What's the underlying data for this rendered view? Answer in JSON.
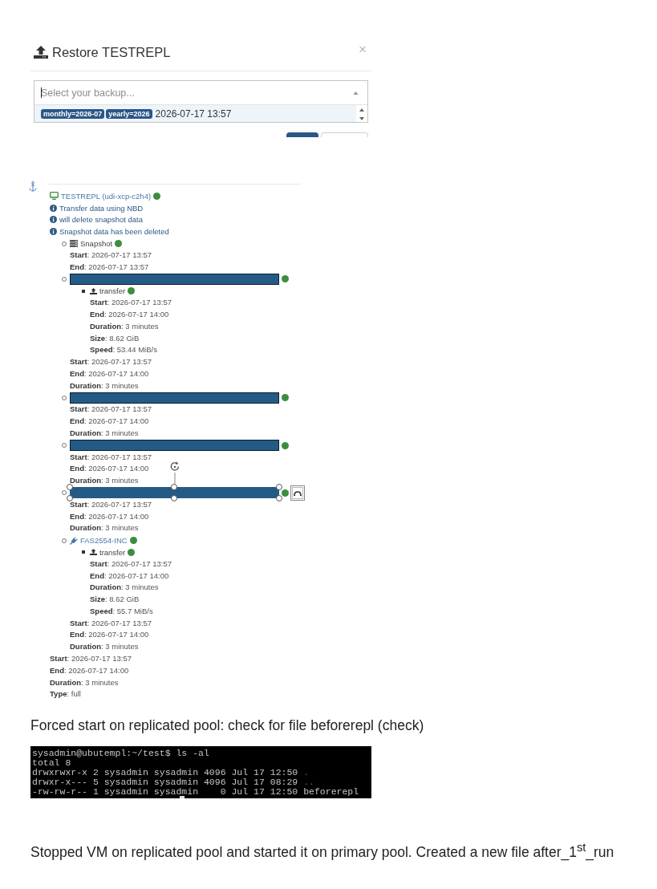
{
  "dialog": {
    "title": "Restore TESTREPL",
    "close": "×",
    "select": {
      "placeholder": "Select your backup...",
      "options": [
        {
          "tags": [
            "monthly=2026-07",
            "yearly=2026"
          ],
          "label": "2026-07-17 13:57",
          "selected": true
        }
      ]
    }
  },
  "log": {
    "kind": "vm",
    "label": "TESTREPL (udi-xcp-c2h4)",
    "color": "#3c8d40",
    "messages": [
      "Transfer data using NBD",
      "will delete snapshot data",
      "Snapshot data has been deleted"
    ],
    "tasks": [
      {
        "kind": "snapshot",
        "label": "Snapshot",
        "color": "#3c8d40",
        "fields": [
          "**Start**: 2026-07-17 13:57",
          "**End**: 2026-07-17 13:57"
        ]
      },
      {
        "kind": "redacted",
        "selected": false,
        "color": "#3c8d40",
        "tasks": [
          {
            "kind": "transfer",
            "label": "transfer",
            "color": "#3c8d40",
            "fields": [
              "**Start**: 2026-07-17 13:57",
              "**End**: 2026-07-17 14:00",
              "**Duration**: 3 minutes",
              "**Size**: 8.62 GiB",
              "**Speed**: 53.44 MiB/s"
            ]
          }
        ],
        "fields": [
          "**Start**: 2026-07-17 13:57",
          "**End**: 2026-07-17 14:00",
          "**Duration**: 3 minutes"
        ]
      },
      {
        "kind": "redacted",
        "selected": false,
        "color": "#3c8d40",
        "fields": [
          "**Start**: 2026-07-17 13:57",
          "**End**: 2026-07-17 14:00",
          "**Duration**: 3 minutes"
        ]
      },
      {
        "kind": "redacted",
        "selected": false,
        "color": "#3c8d40",
        "fields": [
          "**Start**: 2026-07-17 13:57",
          "**End**: 2026-07-17 14:00",
          "**Duration**: 3 minutes"
        ]
      },
      {
        "kind": "redacted",
        "selected": true,
        "color": "#3c8d40",
        "fields": [
          "**Start**: 2026-07-17 13:57",
          "**End**: 2026-07-17 14:00",
          "**Duration**: 3 minutes"
        ]
      },
      {
        "kind": "remote",
        "label": "FAS2554-INC",
        "color": "#3c8d40",
        "tasks": [
          {
            "kind": "transfer",
            "label": "transfer",
            "color": "#3c8d40",
            "fields": [
              "**Start**: 2026-07-17 13:57",
              "**End**: 2026-07-17 14:00",
              "**Duration**: 3 minutes",
              "**Size**: 8.62 GiB",
              "**Speed**: 55.7 MiB/s"
            ]
          }
        ],
        "fields": [
          "**Start**: 2026-07-17 13:57",
          "**End**: 2026-07-17 14:00",
          "**Duration**: 3 minutes"
        ]
      }
    ],
    "fields": [
      "**Start**: 2026-07-17 13:57",
      "**End**: 2026-07-17 14:00",
      "**Duration**: 3 minutes",
      "**Type**: full"
    ]
  },
  "note_1": "Forced start on replicated pool: check for file beforerepl (check)",
  "terminal": {
    "lines": [
      {
        "segments": [
          {
            "kind": "text",
            "text": "sysadmin@ubutempl:~/test$ ls -al"
          }
        ]
      },
      {
        "segments": [
          {
            "kind": "text",
            "text": "total 8"
          }
        ]
      },
      {
        "segments": [
          {
            "kind": "text",
            "text": "drwxrwxr-x 2 sysadmin sysadmin 4096 Jul 17 12:50 "
          },
          {
            "kind": "dir",
            "text": "."
          }
        ]
      },
      {
        "segments": [
          {
            "kind": "text",
            "text": "drwxr-x--- 5 sysadmin sysadmin 4096 Jul 17 08:29 "
          },
          {
            "kind": "dir",
            "text": ".."
          }
        ]
      },
      {
        "segments": [
          {
            "kind": "text",
            "text": "-rw-rw-r-- 1 sysadmin sysadmin    0 Jul 17 12:50 beforerepl"
          }
        ]
      }
    ]
  },
  "note_2": "Stopped VM on replicated pool and started it on primary pool. Created a new file after_1$^{st}$_run"
}
